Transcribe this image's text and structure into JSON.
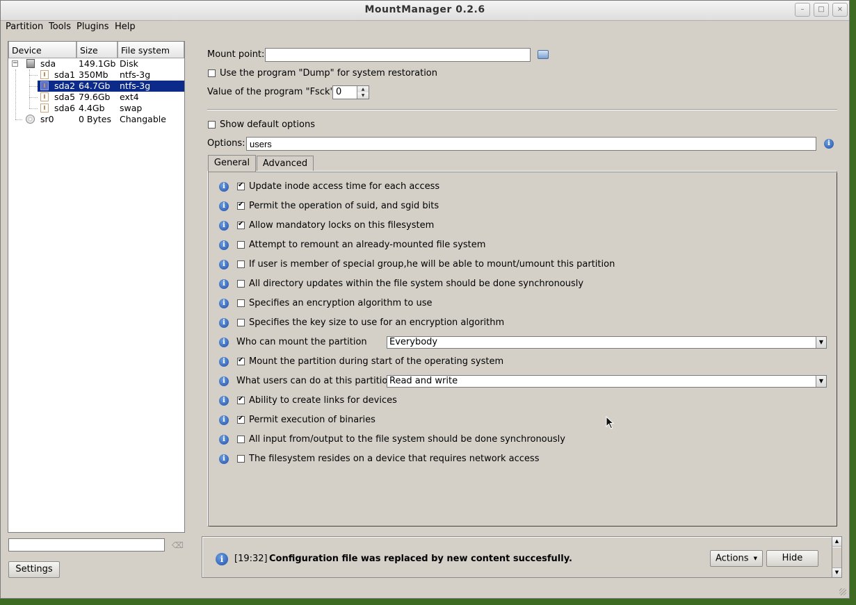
{
  "window": {
    "title": "MountManager 0.2.6",
    "controls": {
      "minimize": "–",
      "maximize": "□",
      "close": "×"
    }
  },
  "menubar": {
    "items": [
      {
        "label": "Partition"
      },
      {
        "label": "Tools"
      },
      {
        "label": "Plugins"
      },
      {
        "label": "Help"
      }
    ]
  },
  "tree": {
    "headers": {
      "device": "Device",
      "size": "Size",
      "filesystem": "File system"
    },
    "rows": [
      {
        "device": "sda",
        "size": "149.1Gb",
        "filesystem": "Disk",
        "icon": "hard-disk-icon"
      },
      {
        "device": "sda1",
        "size": "350Mb",
        "filesystem": "ntfs-3g",
        "icon": "partition-icon"
      },
      {
        "device": "sda2",
        "size": "64.7Gb",
        "filesystem": "ntfs-3g",
        "icon": "partition-icon",
        "selected": true
      },
      {
        "device": "sda5",
        "size": "79.6Gb",
        "filesystem": "ext4",
        "icon": "partition-icon"
      },
      {
        "device": "sda6",
        "size": "4.4Gb",
        "filesystem": "swap",
        "icon": "partition-icon"
      },
      {
        "device": "sr0",
        "size": "0 Bytes",
        "filesystem": "Changable",
        "icon": "cdrom-icon"
      }
    ],
    "expand_toggle": "−",
    "filter_value": ""
  },
  "left": {
    "settings_label": "Settings"
  },
  "mount": {
    "mount_point_label": "Mount point:",
    "mount_point_value": "",
    "dump_label": "Use the program \"Dump\" for system restoration",
    "dump_checked": false,
    "fsck_label": "Value of the program \"Fsck\":",
    "fsck_value": "0",
    "show_default_label": "Show default options",
    "show_default_checked": false,
    "options_label": "Options:",
    "options_value": "users"
  },
  "tabs": [
    {
      "label": "General",
      "active": true
    },
    {
      "label": "Advanced",
      "active": false
    }
  ],
  "general_options": [
    {
      "type": "check",
      "label": "Update inode access time for each access",
      "checked": true
    },
    {
      "type": "check",
      "label": "Permit the operation of suid, and sgid bits",
      "checked": true
    },
    {
      "type": "check",
      "label": "Allow mandatory locks on this filesystem",
      "checked": true
    },
    {
      "type": "check",
      "label": "Attempt to remount an already-mounted file system",
      "checked": false
    },
    {
      "type": "check",
      "label": "If user is member of special group,he will be able to mount/umount this partition",
      "checked": false
    },
    {
      "type": "check",
      "label": "All  directory  updates within the file system should be done synchronously",
      "checked": false
    },
    {
      "type": "check",
      "label": "Specifies an encryption algorithm to use",
      "checked": false
    },
    {
      "type": "check",
      "label": "Specifies the key size to use for an encryption algorithm",
      "checked": false
    },
    {
      "type": "combo",
      "label": "Who can mount the partition",
      "value": "Everybody"
    },
    {
      "type": "check",
      "label": "Mount the partition during start of the operating system",
      "checked": true
    },
    {
      "type": "combo",
      "label": "What users can do at this partition",
      "value": "Read and write"
    },
    {
      "type": "check",
      "label": "Ability to create links for devices",
      "checked": true
    },
    {
      "type": "check",
      "label": "Permit execution of binaries",
      "checked": true
    },
    {
      "type": "check",
      "label": "All input from/output to the file system should be done synchronously",
      "checked": false
    },
    {
      "type": "check",
      "label": "The filesystem resides on a device that requires network access",
      "checked": false
    }
  ],
  "status": {
    "time": "[19:32]",
    "message": "Configuration file was replaced by new content succesfully.",
    "actions_label": "Actions",
    "hide_label": "Hide"
  }
}
